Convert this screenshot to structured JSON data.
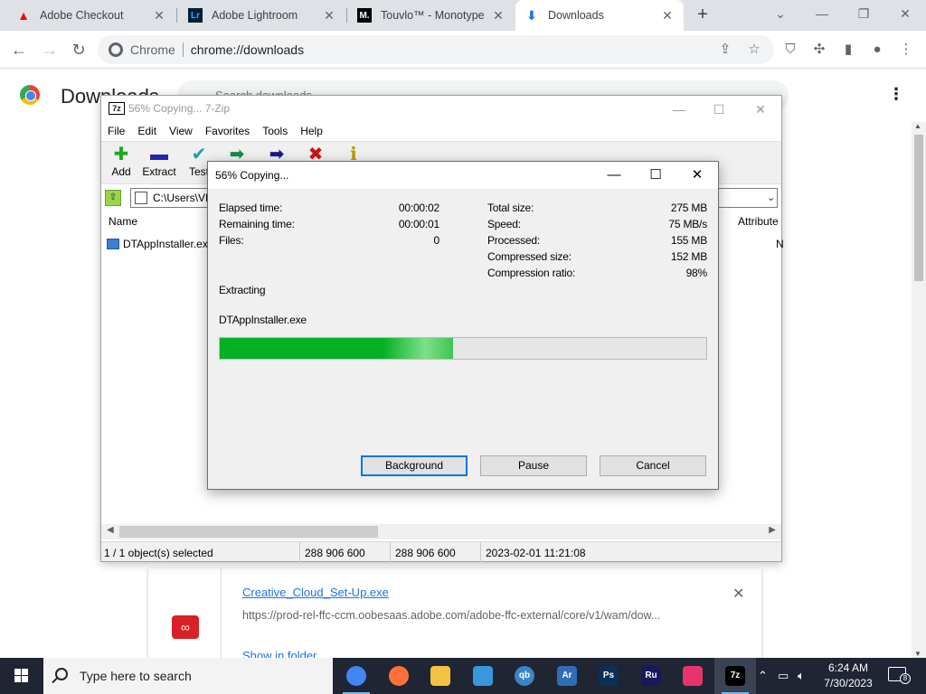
{
  "browser": {
    "tabs": [
      {
        "title": "Adobe Checkout",
        "favicon": "adobe-icon",
        "active": false
      },
      {
        "title": "Adobe Lightroom",
        "favicon": "lightroom-icon",
        "active": false
      },
      {
        "title": "Touvlo™ - Monotype",
        "favicon": "monotype-icon",
        "active": false
      },
      {
        "title": "Downloads",
        "favicon": "download-icon",
        "active": true
      }
    ],
    "address": {
      "scheme": "Chrome",
      "url": "chrome://downloads"
    }
  },
  "downloads_page": {
    "title": "Downloads",
    "search_placeholder": "Search downloads",
    "item": {
      "filename": "Creative_Cloud_Set-Up.exe",
      "url": "https://prod-rel-ffc-ccm.oobesaas.adobe.com/adobe-ffc-external/core/v1/wam/dow...",
      "show_label": "Show in folder"
    }
  },
  "sevenzip": {
    "window_title": "56% Copying... 7-Zip",
    "menu": [
      "File",
      "Edit",
      "View",
      "Favorites",
      "Tools",
      "Help"
    ],
    "toolbar": [
      {
        "label": "Add",
        "icon": "add-icon",
        "color": "#1bab1b",
        "glyph": "✚"
      },
      {
        "label": "Extract",
        "icon": "extract-icon",
        "color": "#2424b8",
        "glyph": "▬"
      },
      {
        "label": "Test",
        "icon": "test-icon",
        "color": "#1aa3a3",
        "glyph": "✔"
      },
      {
        "label": "Copy",
        "icon": "copy-icon",
        "color": "#1a8a4a",
        "glyph": "➡"
      },
      {
        "label": "Move",
        "icon": "move-icon",
        "color": "#1a1a8a",
        "glyph": "➡"
      },
      {
        "label": "Delete",
        "icon": "delete-icon",
        "color": "#d01010",
        "glyph": "✖"
      },
      {
        "label": "Info",
        "icon": "info-icon",
        "color": "#b59a00",
        "glyph": "ℹ"
      }
    ],
    "path": "C:\\Users\\VM",
    "columns": {
      "name": "Name",
      "attributes": "Attribute"
    },
    "file": {
      "name": "DTAppInstaller.exe",
      "attr": "N"
    },
    "status": {
      "selected": "1 / 1 object(s) selected",
      "size": "288 906 600",
      "packed": "288 906 600",
      "modified": "2023-02-01 11:21:08"
    }
  },
  "dialog": {
    "title": "56% Copying...",
    "left_stats": [
      {
        "label": "Elapsed time:",
        "value": "00:00:02"
      },
      {
        "label": "Remaining time:",
        "value": "00:00:01"
      },
      {
        "label": "Files:",
        "value": "0"
      }
    ],
    "right_stats": [
      {
        "label": "Total size:",
        "value": "275 MB"
      },
      {
        "label": "Speed:",
        "value": "75 MB/s"
      },
      {
        "label": "Processed:",
        "value": "155 MB"
      },
      {
        "label": "Compressed size:",
        "value": "152 MB"
      },
      {
        "label": "Compression ratio:",
        "value": "98%"
      }
    ],
    "operation": "Extracting",
    "current_file": "DTAppInstaller.exe",
    "progress_fraction": 0.48,
    "buttons": {
      "background": "Background",
      "pause": "Pause",
      "cancel": "Cancel"
    }
  },
  "taskbar": {
    "search_placeholder": "Type here to search",
    "apps": [
      {
        "name": "chrome-taskbar-icon",
        "glyph": "",
        "color": "#4285f4",
        "active": false
      },
      {
        "name": "firefox-taskbar-icon",
        "glyph": "",
        "color": "#ff7139",
        "active": false
      },
      {
        "name": "file-explorer-taskbar-icon",
        "glyph": "",
        "color": "#f2c343",
        "active": false
      },
      {
        "name": "store-taskbar-icon",
        "glyph": "",
        "color": "#3a96dd",
        "active": false
      },
      {
        "name": "qbittorrent-taskbar-icon",
        "glyph": "qb",
        "color": "#3d84c6",
        "active": false
      },
      {
        "name": "acrobat-reader-taskbar-icon",
        "glyph": "Ar",
        "color": "#2f6db5",
        "active": false
      },
      {
        "name": "photoshop-taskbar-icon",
        "glyph": "Ps",
        "color": "#0b2f55",
        "active": false
      },
      {
        "name": "premiere-rush-taskbar-icon",
        "glyph": "Ru",
        "color": "#18185a",
        "active": false
      },
      {
        "name": "creative-cloud-taskbar-icon",
        "glyph": "",
        "color": "#e8336d",
        "active": false
      },
      {
        "name": "7zip-taskbar-icon",
        "glyph": "7z",
        "color": "#000000",
        "active": true
      }
    ],
    "time": "6:24 AM",
    "date": "7/30/2023",
    "notifications": "8"
  }
}
